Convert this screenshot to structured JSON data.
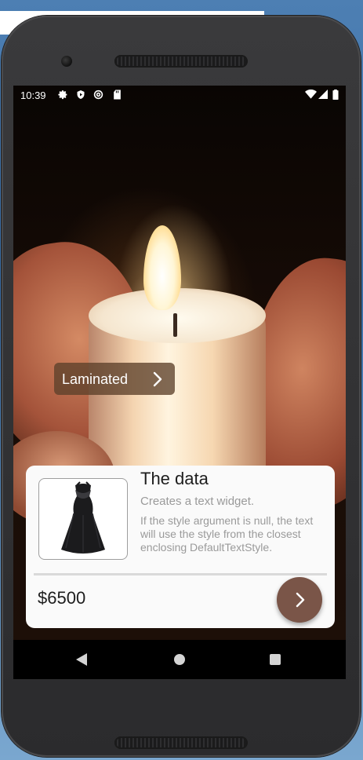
{
  "status_bar": {
    "time": "10:39",
    "left_icons": [
      "gear-icon",
      "shield-icon",
      "at-icon",
      "sd-card-icon"
    ],
    "right_icons": [
      "wifi-icon",
      "signal-icon",
      "battery-icon"
    ]
  },
  "chip": {
    "label": "Laminated"
  },
  "card": {
    "title": "The data",
    "subtitle": "Creates a text widget.",
    "description": "If the style argument is null, the text will use the style from the closest enclosing DefaultTextStyle.",
    "price": "$6500"
  },
  "colors": {
    "fab": "#7a5548",
    "chip_bg": "#5c402a",
    "card_bg": "#fafafa",
    "muted_text": "#9a9a9a"
  },
  "navigation": [
    "back-icon",
    "home-icon",
    "recents-icon"
  ]
}
